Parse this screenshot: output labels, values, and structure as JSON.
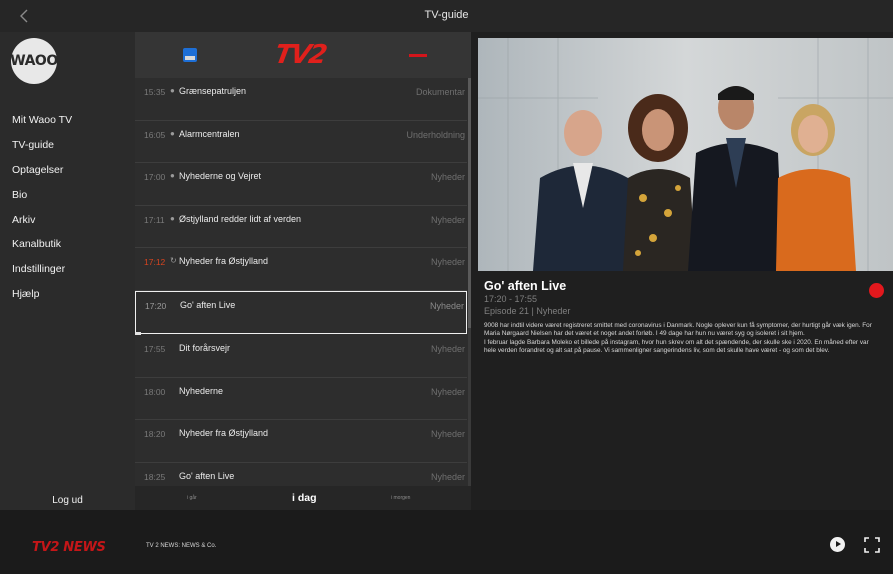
{
  "header": {
    "title": "TV-guide",
    "back_icon": "chevron-left-icon"
  },
  "sidebar": {
    "logo": "WAOO",
    "items": [
      {
        "label": "Mit Waoo TV"
      },
      {
        "label": "TV-guide"
      },
      {
        "label": "Optagelser"
      },
      {
        "label": "Bio"
      },
      {
        "label": "Arkiv"
      },
      {
        "label": "Kanalbutik"
      },
      {
        "label": "Indstillinger"
      },
      {
        "label": "Hjælp"
      }
    ],
    "logout": "Log ud"
  },
  "channels": [
    {
      "name": "TV 2 Østjylland",
      "icon": "tv2-small-logo"
    },
    {
      "name": "TV 2",
      "logo": "TV2"
    },
    {
      "name": "channel-3",
      "icon": "red-dash-logo"
    }
  ],
  "programs": [
    {
      "time": "15:35",
      "icon": "clock-icon",
      "title": "Grænsepatruljen",
      "genre": "Dokumentar"
    },
    {
      "time": "16:05",
      "icon": "clock-icon",
      "title": "Alarmcentralen",
      "genre": "Underholdning"
    },
    {
      "time": "17:00",
      "icon": "clock-icon",
      "title": "Nyhederne og Vejret",
      "genre": "Nyheder"
    },
    {
      "time": "17:11",
      "icon": "clock-icon",
      "title": "Østjylland redder lidt af verden",
      "genre": "Nyheder"
    },
    {
      "time": "17:12",
      "icon": "restart-icon",
      "title": "Nyheder fra Østjylland",
      "genre": "Nyheder",
      "live": true
    },
    {
      "time": "17:20",
      "title": "Go' aften Live",
      "genre": "Nyheder",
      "selected": true
    },
    {
      "time": "17:55",
      "title": "Dit forårsvejr",
      "genre": "Nyheder"
    },
    {
      "time": "18:00",
      "title": "Nyhederne",
      "genre": "Nyheder"
    },
    {
      "time": "18:20",
      "title": "Nyheder fra Østjylland",
      "genre": "Nyheder"
    },
    {
      "time": "18:25",
      "title": "Go' aften Live",
      "genre": "Nyheder"
    }
  ],
  "daybar": {
    "prev": "i går",
    "current": "i dag",
    "next": "i morgen"
  },
  "detail": {
    "title": "Go' aften Live",
    "time": "17:20 - 17:55",
    "episode": "Episode 21 | Nyheder",
    "description": [
      "9008 har indtil videre været registreret smittet med coronavirus i Danmark. Nogle oplever kun få symptomer, der hurtigt går væk igen. For Maria Nørgaard Nielsen har det været et noget andet forløb. I 49 dage har hun nu været syg og isoleret i sit hjem.",
      "I februar lagde Barbara Moleko et billede på instagram, hvor hun skrev om alt det spændende, der skulle ske i 2020. En måned efter var hele verden forandret og alt sat på pause. Vi sammenligner sangerindens liv, som det skulle have været - og som det blev."
    ],
    "record_icon": "record-icon"
  },
  "player": {
    "channel_logo": "TV2 NEWS",
    "now_playing": "TV 2 NEWS: NEWS & Co.",
    "play_icon": "play-icon",
    "fullscreen_icon": "fullscreen-icon"
  },
  "colors": {
    "record": "#e2181d",
    "live_time": "#d7441f",
    "tv2_red": "#e0201c"
  }
}
